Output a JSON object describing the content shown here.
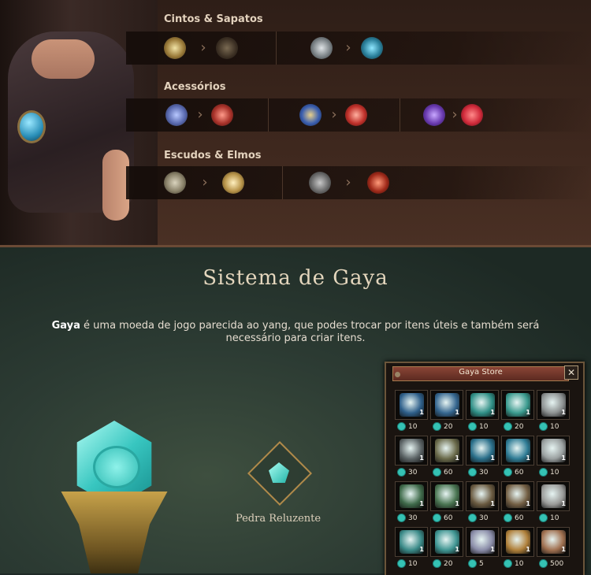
{
  "categories": [
    {
      "title": "Cintos & Sapatos",
      "pairs": [
        {
          "from": "ring-belt-icon",
          "to": "dark-belt-icon"
        },
        {
          "from": "silver-shoe-icon",
          "to": "blue-shoe-icon"
        }
      ]
    },
    {
      "title": "Acessórios",
      "pairs": [
        {
          "from": "bracelet-icon",
          "to": "ruby-bracelet-icon"
        },
        {
          "from": "sapphire-necklace-icon",
          "to": "ruby-necklace-icon"
        },
        {
          "from": "purple-earring-icon",
          "to": "red-earring-icon"
        }
      ]
    },
    {
      "title": "Escudos & Elmos",
      "pairs": [
        {
          "from": "round-shield-icon",
          "to": "gold-shield-icon"
        },
        {
          "from": "iron-helmet-icon",
          "to": "red-helmet-icon"
        }
      ]
    }
  ],
  "gaya": {
    "title": "Sistema de Gaya",
    "desc_bold": "Gaya",
    "desc_rest": " é uma moeda de jogo parecida ao yang, que podes trocar por itens úteis e também será necessário para criar itens.",
    "stone_label": "Pedra Reluzente"
  },
  "store": {
    "title": "Gaya Store",
    "close": "✕",
    "rows": [
      [
        {
          "icon": "blue-ring-icon",
          "qty": "1",
          "price": "10",
          "color": "#2e5f8a"
        },
        {
          "icon": "blue-ring-icon",
          "qty": "1",
          "price": "20",
          "color": "#35668f"
        },
        {
          "icon": "teal-bracelet-icon",
          "qty": "1",
          "price": "10",
          "color": "#2f8f86"
        },
        {
          "icon": "teal-bracelet-icon",
          "qty": "1",
          "price": "20",
          "color": "#3a9a8e"
        },
        {
          "icon": "silver-orb-icon",
          "qty": "1",
          "price": "10",
          "color": "#8c9090"
        }
      ],
      [
        {
          "icon": "silver-ring-icon",
          "qty": "1",
          "price": "30",
          "color": "#5c6466"
        },
        {
          "icon": "gold-ring-icon",
          "qty": "1",
          "price": "60",
          "color": "#6a6a4a"
        },
        {
          "icon": "blue-bangle-icon",
          "qty": "1",
          "price": "30",
          "color": "#2a6f8a"
        },
        {
          "icon": "blue-bangle-icon",
          "qty": "1",
          "price": "60",
          "color": "#2f7c95"
        },
        {
          "icon": "silver-pendant-icon",
          "qty": "1",
          "price": "10",
          "color": "#9aa0a0"
        }
      ],
      [
        {
          "icon": "green-book-icon",
          "qty": "1",
          "price": "30",
          "color": "#3f6a4a"
        },
        {
          "icon": "green-book-icon",
          "qty": "1",
          "price": "60",
          "color": "#4a7552"
        },
        {
          "icon": "beast-book-icon",
          "qty": "1",
          "price": "30",
          "color": "#6a5a40"
        },
        {
          "icon": "beast-book-icon",
          "qty": "1",
          "price": "60",
          "color": "#735f44"
        },
        {
          "icon": "silver-disc-icon",
          "qty": "1",
          "price": "10",
          "color": "#9a9a98"
        }
      ],
      [
        {
          "icon": "teal-cube-icon",
          "qty": "1",
          "price": "10",
          "color": "#3a8a88"
        },
        {
          "icon": "teal-cube-icon",
          "qty": "1",
          "price": "20",
          "color": "#3f9592"
        },
        {
          "icon": "potion-bottle-icon",
          "qty": "1",
          "price": "5",
          "color": "#8a8ca8"
        },
        {
          "icon": "compass-icon",
          "qty": "1",
          "price": "10",
          "color": "#b0803a"
        },
        {
          "icon": "map-scroll-icon",
          "qty": "1",
          "price": "500",
          "color": "#a07050"
        }
      ]
    ]
  }
}
